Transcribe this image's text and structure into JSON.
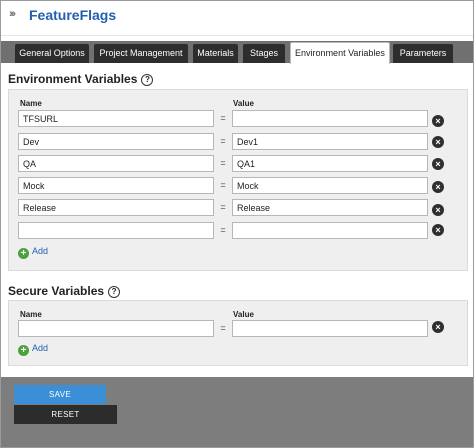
{
  "header": {
    "title": "FeatureFlags",
    "chevrons": "›››"
  },
  "tabs": [
    {
      "label": "General Options",
      "active": false
    },
    {
      "label": "Project Management",
      "active": false
    },
    {
      "label": "Materials",
      "active": false
    },
    {
      "label": "Stages",
      "active": false
    },
    {
      "label": "Environment Variables",
      "active": true
    },
    {
      "label": "Parameters",
      "active": false
    }
  ],
  "environment": {
    "title": "Environment Variables",
    "name_header": "Name",
    "value_header": "Value",
    "equals": "=",
    "rows": [
      {
        "name": "TFSURL",
        "value": ""
      },
      {
        "name": "Dev",
        "value": "Dev1"
      },
      {
        "name": "QA",
        "value": "QA1"
      },
      {
        "name": "Mock",
        "value": "Mock"
      },
      {
        "name": "Release",
        "value": "Release"
      },
      {
        "name": "",
        "value": ""
      }
    ],
    "add_label": "Add"
  },
  "secure": {
    "title": "Secure Variables",
    "name_header": "Name",
    "value_header": "Value",
    "equals": "=",
    "rows": [
      {
        "name": "",
        "value": ""
      }
    ],
    "add_label": "Add"
  },
  "buttons": {
    "save": "SAVE",
    "reset": "RESET"
  },
  "icons": {
    "help": "?",
    "delete": "×",
    "add": "+"
  },
  "colors": {
    "accent": "#235fb0",
    "save": "#3b8fd6",
    "add": "#4aa23a",
    "tab_dark": "#2d2d2d"
  }
}
